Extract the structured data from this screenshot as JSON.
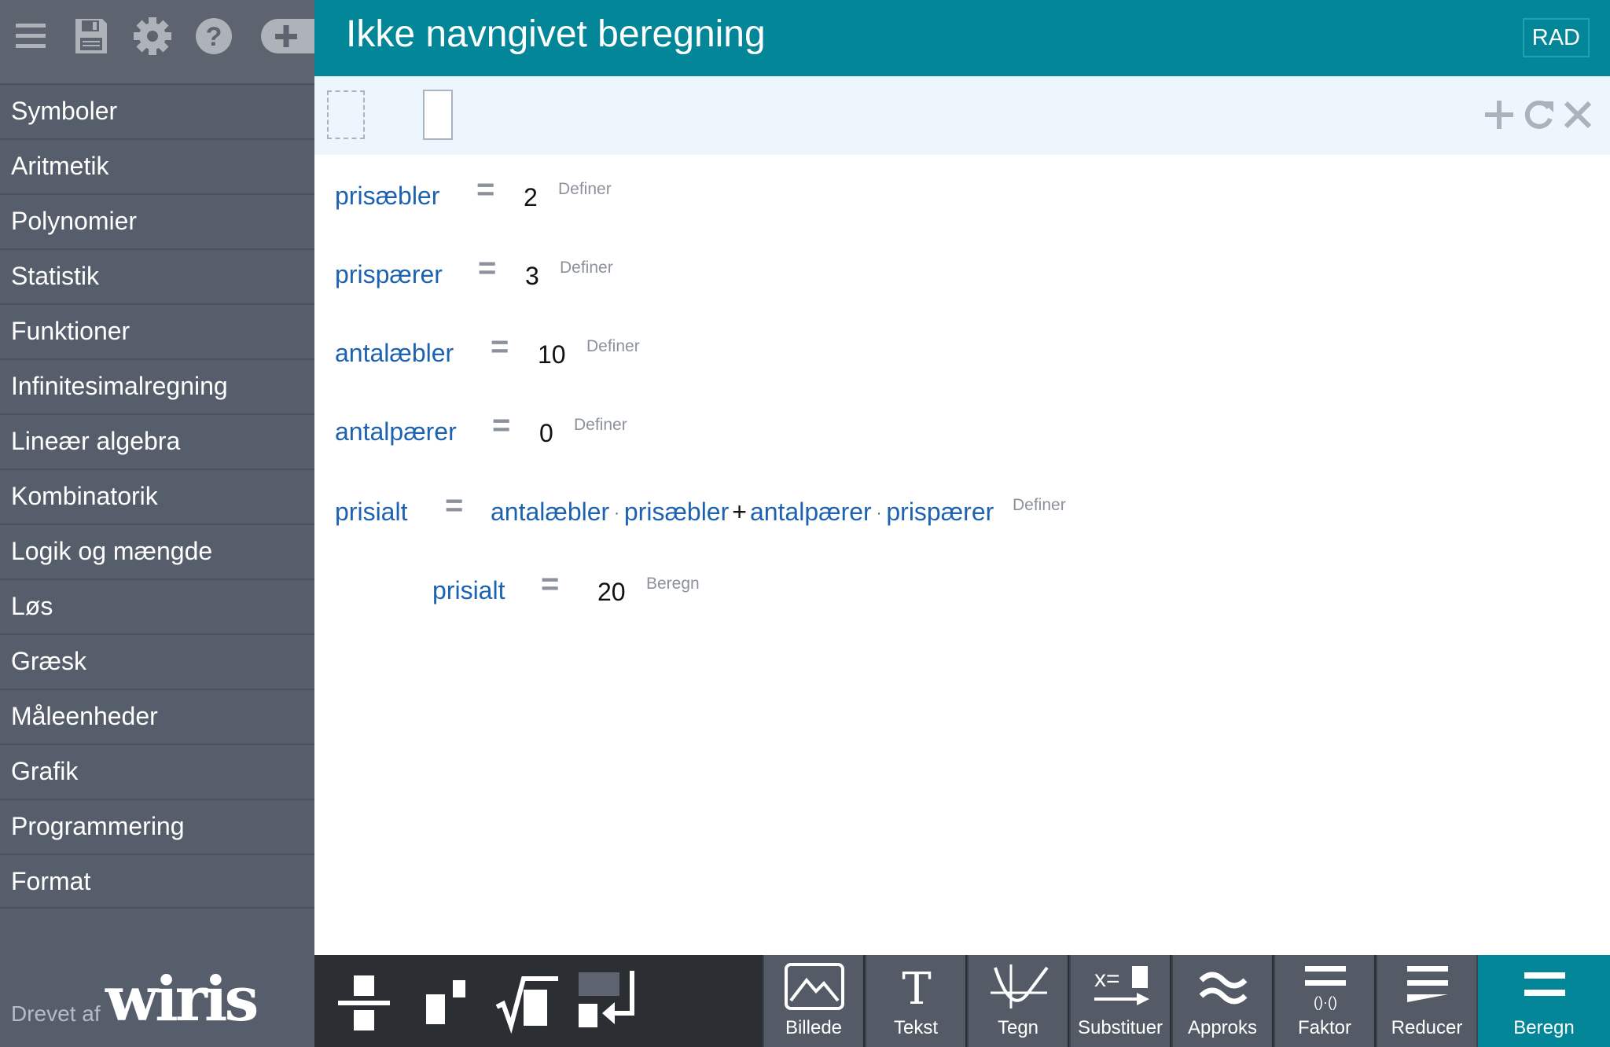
{
  "sidebar": {
    "toolbar": {
      "icons": [
        "hamburger-menu-icon",
        "save-icon",
        "settings-gear-icon",
        "help-icon",
        "add-tab-icon"
      ]
    },
    "menu": [
      {
        "label": "Symboler"
      },
      {
        "label": "Aritmetik"
      },
      {
        "label": "Polynomier"
      },
      {
        "label": "Statistik"
      },
      {
        "label": "Funktioner"
      },
      {
        "label": "Infinitesimalregning"
      },
      {
        "label": "Lineær algebra"
      },
      {
        "label": "Kombinatorik"
      },
      {
        "label": "Logik og mængde"
      },
      {
        "label": "Løs"
      },
      {
        "label": "Græsk"
      },
      {
        "label": "Måleenheder"
      },
      {
        "label": "Grafik"
      },
      {
        "label": "Programmering"
      },
      {
        "label": "Format"
      }
    ],
    "powered": {
      "text": "Drevet af",
      "logo": "wiris"
    }
  },
  "header": {
    "title": "Ikke navngivet beregning",
    "angle_mode": "RAD"
  },
  "editbar": {
    "icons": [
      "add-icon",
      "refresh-icon",
      "close-icon"
    ]
  },
  "worksheet": {
    "rows": [
      {
        "variable": "prisæbler",
        "equals": "=",
        "value": "2",
        "action": "Definer"
      },
      {
        "variable": "prispærer",
        "equals": "=",
        "value": "3",
        "action": "Definer"
      },
      {
        "variable": "antalæbler",
        "equals": "=",
        "value": "10",
        "action": "Definer"
      },
      {
        "variable": "antalpærer",
        "equals": "=",
        "value": "0",
        "action": "Definer"
      },
      {
        "variable": "prisialt",
        "equals": "=",
        "expression": {
          "t1a": "antalæbler",
          "dot1": "·",
          "t1b": "prisæbler",
          "plus": "+",
          "t2a": "antalpærer",
          "dot2": "·",
          "t2b": "prispærer"
        },
        "action": "Definer"
      },
      {
        "variable": "prisialt",
        "equals": "=",
        "value": "20",
        "action": "Beregn"
      }
    ]
  },
  "bottombar": {
    "templates": [
      "fraction-icon",
      "superscript-icon",
      "square-root-icon",
      "matrix-new-line-icon"
    ],
    "commands": [
      {
        "label": "Billede",
        "icon": "image-icon"
      },
      {
        "label": "Tekst",
        "icon": "text-icon"
      },
      {
        "label": "Tegn",
        "icon": "plot-icon"
      },
      {
        "label": "Substituer",
        "icon": "substitute-icon"
      },
      {
        "label": "Approks",
        "icon": "approximate-icon"
      },
      {
        "label": "Faktor",
        "icon": "factor-icon"
      },
      {
        "label": "Reducer",
        "icon": "reduce-icon"
      },
      {
        "label": "Beregn",
        "icon": "calculate-icon"
      }
    ]
  },
  "colors": {
    "header": "#038698",
    "sidebar": "#565e6b",
    "accent_blue": "#1d62b0",
    "toolbar_dark": "#2b2f34"
  }
}
